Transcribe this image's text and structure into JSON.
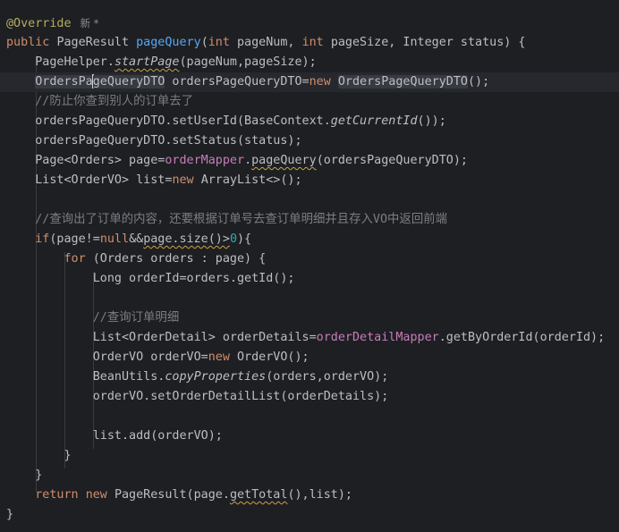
{
  "editor": {
    "inlay_hint": "新 *",
    "lines": [
      {
        "segments": [
          {
            "t": "@Override",
            "c": "annotation"
          }
        ]
      },
      {
        "segments": [
          {
            "t": "public ",
            "c": "kw"
          },
          {
            "t": "PageResult ",
            "c": "plain"
          },
          {
            "t": "pageQuery",
            "c": "fn-decl"
          },
          {
            "t": "(",
            "c": "plain"
          },
          {
            "t": "int ",
            "c": "kw"
          },
          {
            "t": "pageNum, ",
            "c": "plain"
          },
          {
            "t": "int ",
            "c": "kw"
          },
          {
            "t": "pageSize, Integer status) {",
            "c": "plain"
          }
        ]
      },
      {
        "segments": [
          {
            "t": "    PageHelper.",
            "c": "plain"
          },
          {
            "t": "startPage",
            "c": "static-call squiggle"
          },
          {
            "t": "(pageNum,pageSize);",
            "c": "plain"
          }
        ]
      },
      {
        "caret": true,
        "segments": [
          {
            "t": "    ",
            "c": "plain"
          },
          {
            "t": "OrdersPa",
            "c": "plain hl-usage"
          },
          {
            "t": "|",
            "c": "caret"
          },
          {
            "t": "geQueryDTO",
            "c": "plain hl-usage"
          },
          {
            "t": " ordersPageQueryDTO=",
            "c": "plain"
          },
          {
            "t": "new ",
            "c": "kw"
          },
          {
            "t": "OrdersPageQueryDTO",
            "c": "plain hl-usage"
          },
          {
            "t": "();",
            "c": "plain"
          }
        ]
      },
      {
        "segments": [
          {
            "t": "    //防止你查到别人的订单去了",
            "c": "comment"
          }
        ]
      },
      {
        "segments": [
          {
            "t": "    ordersPageQueryDTO.setUserId(BaseContext.",
            "c": "plain"
          },
          {
            "t": "getCurrentId",
            "c": "static-call"
          },
          {
            "t": "());",
            "c": "plain"
          }
        ]
      },
      {
        "segments": [
          {
            "t": "    ordersPageQueryDTO.setStatus(status);",
            "c": "plain"
          }
        ]
      },
      {
        "segments": [
          {
            "t": "    Page<Orders> page=",
            "c": "plain"
          },
          {
            "t": "orderMapper",
            "c": "field"
          },
          {
            "t": ".",
            "c": "plain"
          },
          {
            "t": "pageQuery",
            "c": "plain squiggle"
          },
          {
            "t": "(ordersPageQueryDTO);",
            "c": "plain"
          }
        ]
      },
      {
        "segments": [
          {
            "t": "    List<OrderVO> list=",
            "c": "plain"
          },
          {
            "t": "new ",
            "c": "kw"
          },
          {
            "t": "ArrayList<>();",
            "c": "plain"
          }
        ]
      },
      {
        "segments": []
      },
      {
        "segments": [
          {
            "t": "    //查询出了订单的内容，还要根据订单号去查订单明细并且存入VO中返回前端",
            "c": "comment"
          }
        ]
      },
      {
        "segments": [
          {
            "t": "    ",
            "c": "plain"
          },
          {
            "t": "if",
            "c": "kw"
          },
          {
            "t": "(page!=",
            "c": "plain"
          },
          {
            "t": "null",
            "c": "kw"
          },
          {
            "t": "&&",
            "c": "plain"
          },
          {
            "t": "page.size()>",
            "c": "plain squiggle"
          },
          {
            "t": "0",
            "c": "num"
          },
          {
            "t": "){",
            "c": "plain"
          }
        ]
      },
      {
        "segments": [
          {
            "t": "        ",
            "c": "plain"
          },
          {
            "t": "for ",
            "c": "kw"
          },
          {
            "t": "(Orders orders : page) {",
            "c": "plain"
          }
        ]
      },
      {
        "segments": [
          {
            "t": "            Long orderId=orders.getId();",
            "c": "plain"
          }
        ]
      },
      {
        "segments": []
      },
      {
        "segments": [
          {
            "t": "            //查询订单明细",
            "c": "comment"
          }
        ]
      },
      {
        "segments": [
          {
            "t": "            List<OrderDetail> orderDetails=",
            "c": "plain"
          },
          {
            "t": "orderDetailMapper",
            "c": "field"
          },
          {
            "t": ".getByOrderId(orderId);",
            "c": "plain"
          }
        ]
      },
      {
        "segments": [
          {
            "t": "            OrderVO orderVO=",
            "c": "plain"
          },
          {
            "t": "new ",
            "c": "kw"
          },
          {
            "t": "OrderVO();",
            "c": "plain"
          }
        ]
      },
      {
        "segments": [
          {
            "t": "            BeanUtils.",
            "c": "plain"
          },
          {
            "t": "copyProperties",
            "c": "static-call"
          },
          {
            "t": "(orders,orderVO);",
            "c": "plain"
          }
        ]
      },
      {
        "segments": [
          {
            "t": "            orderVO.setOrderDetailList(orderDetails);",
            "c": "plain"
          }
        ]
      },
      {
        "segments": []
      },
      {
        "segments": [
          {
            "t": "            list.add(orderVO);",
            "c": "plain"
          }
        ]
      },
      {
        "segments": [
          {
            "t": "        }",
            "c": "plain"
          }
        ]
      },
      {
        "segments": [
          {
            "t": "    }",
            "c": "plain"
          }
        ]
      },
      {
        "segments": [
          {
            "t": "    ",
            "c": "plain"
          },
          {
            "t": "return ",
            "c": "kw"
          },
          {
            "t": "new ",
            "c": "kw"
          },
          {
            "t": "PageResult(page.",
            "c": "plain"
          },
          {
            "t": "getTotal",
            "c": "plain squiggle"
          },
          {
            "t": "(),list);",
            "c": "plain"
          }
        ]
      },
      {
        "segments": [
          {
            "t": "}",
            "c": "plain"
          }
        ]
      }
    ]
  }
}
